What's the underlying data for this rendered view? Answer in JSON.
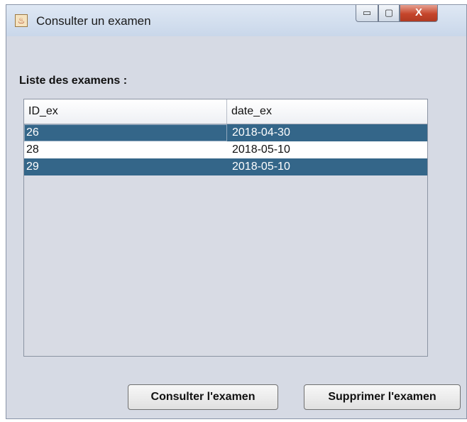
{
  "window": {
    "title": "Consulter un examen",
    "controls": {
      "minimize": "▭",
      "maximize": "▢",
      "close": "X"
    }
  },
  "list_label": "Liste des examens :",
  "table": {
    "columns": [
      "ID_ex",
      "date_ex"
    ],
    "rows": [
      {
        "id": "26",
        "date": "2018-04-30",
        "selected": true
      },
      {
        "id": "28",
        "date": "2018-05-10",
        "selected": false
      },
      {
        "id": "29",
        "date": "2018-05-10",
        "selected": true
      }
    ]
  },
  "buttons": {
    "consult": "Consulter l'examen",
    "delete": "Supprimer l'examen"
  },
  "colors": {
    "selection": "#346689",
    "window_bg": "#d6dae4"
  }
}
